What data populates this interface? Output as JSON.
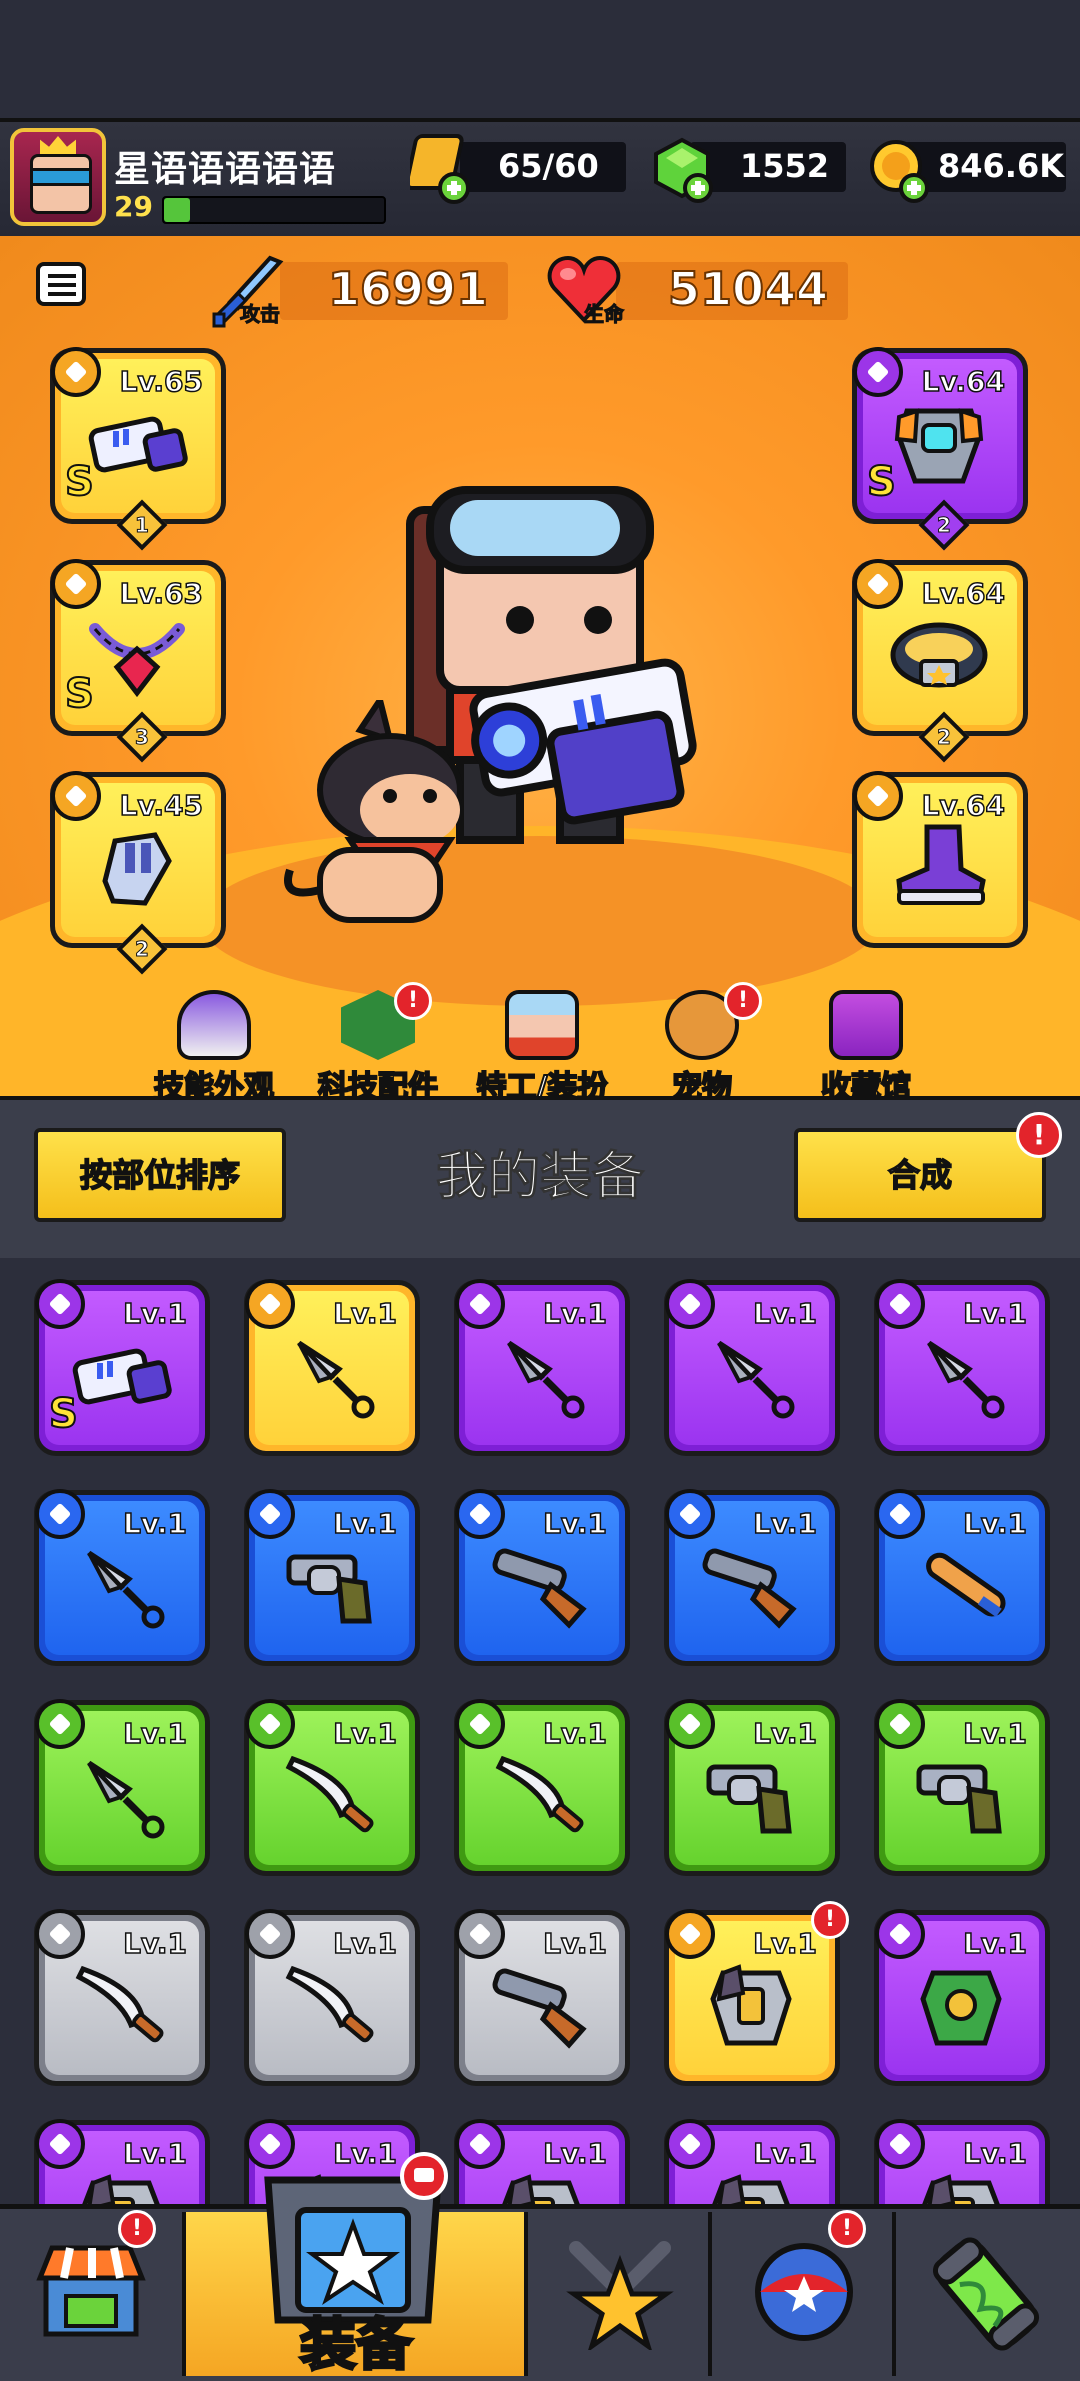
{
  "player": {
    "name": "星语语语语语",
    "level": "29",
    "xp_progress": 0.12
  },
  "resources": [
    {
      "name": "energy",
      "icon": "energy-ticket-icon",
      "value": "65/60"
    },
    {
      "name": "gems",
      "icon": "green-gem-icon",
      "value": "1552"
    },
    {
      "name": "coins",
      "icon": "gold-coin-icon",
      "value": "846.6K"
    }
  ],
  "stats": {
    "attack": {
      "label": "攻击",
      "value": "16991",
      "icon": "sword-icon"
    },
    "health": {
      "label": "生命",
      "value": "51044",
      "icon": "heart-icon"
    }
  },
  "equipped": {
    "left": [
      {
        "level": "Lv.65",
        "grade": "S",
        "star": "1",
        "rarity": "gold",
        "type": "weapon"
      },
      {
        "level": "Lv.63",
        "grade": "S",
        "star": "3",
        "rarity": "gold",
        "type": "necklace"
      },
      {
        "level": "Lv.45",
        "grade": "",
        "star": "2",
        "rarity": "gold",
        "type": "gloves"
      }
    ],
    "right": [
      {
        "level": "Lv.64",
        "grade": "S",
        "star": "2",
        "rarity": "purple",
        "type": "armor"
      },
      {
        "level": "Lv.64",
        "grade": "",
        "star": "2",
        "rarity": "gold",
        "type": "belt"
      },
      {
        "level": "Lv.64",
        "grade": "",
        "star": "",
        "rarity": "gold",
        "type": "boots"
      }
    ]
  },
  "nav": [
    {
      "label": "技能外观",
      "icon": "skill-skin-icon",
      "alert": false
    },
    {
      "label": "科技配件",
      "icon": "tech-part-icon",
      "alert": true
    },
    {
      "label": "特工/装扮",
      "icon": "agent-icon",
      "alert": false
    },
    {
      "label": "宠物",
      "icon": "pet-icon",
      "alert": true
    },
    {
      "label": "收藏馆",
      "icon": "collection-icon",
      "alert": false
    }
  ],
  "equip_section": {
    "sort_label": "按部位排序",
    "title": "我的装备",
    "merge_label": "合成",
    "merge_alert": "!"
  },
  "inventory": [
    [
      {
        "level": "Lv.1",
        "rarity": "purple",
        "item": "blaster",
        "grade": "S"
      },
      {
        "level": "Lv.1",
        "rarity": "gold",
        "item": "kunai"
      },
      {
        "level": "Lv.1",
        "rarity": "purple",
        "item": "kunai"
      },
      {
        "level": "Lv.1",
        "rarity": "purple",
        "item": "kunai"
      },
      {
        "level": "Lv.1",
        "rarity": "purple",
        "item": "kunai"
      }
    ],
    [
      {
        "level": "Lv.1",
        "rarity": "blue",
        "item": "kunai"
      },
      {
        "level": "Lv.1",
        "rarity": "blue",
        "item": "revolver"
      },
      {
        "level": "Lv.1",
        "rarity": "blue",
        "item": "shotgun"
      },
      {
        "level": "Lv.1",
        "rarity": "blue",
        "item": "shotgun"
      },
      {
        "level": "Lv.1",
        "rarity": "blue",
        "item": "bat"
      }
    ],
    [
      {
        "level": "Lv.1",
        "rarity": "green",
        "item": "kunai"
      },
      {
        "level": "Lv.1",
        "rarity": "green",
        "item": "machete"
      },
      {
        "level": "Lv.1",
        "rarity": "green",
        "item": "machete"
      },
      {
        "level": "Lv.1",
        "rarity": "green",
        "item": "revolver"
      },
      {
        "level": "Lv.1",
        "rarity": "green",
        "item": "revolver"
      }
    ],
    [
      {
        "level": "Lv.1",
        "rarity": "gray",
        "item": "machete"
      },
      {
        "level": "Lv.1",
        "rarity": "gray",
        "item": "machete"
      },
      {
        "level": "Lv.1",
        "rarity": "gray",
        "item": "shotgun"
      },
      {
        "level": "Lv.1",
        "rarity": "gold",
        "item": "armor",
        "alert": true
      },
      {
        "level": "Lv.1",
        "rarity": "purple",
        "item": "armor-green"
      }
    ],
    [
      {
        "level": "Lv.1",
        "rarity": "purple",
        "item": "armor"
      },
      {
        "level": "Lv.1",
        "rarity": "purple",
        "item": "armor"
      },
      {
        "level": "Lv.1",
        "rarity": "purple",
        "item": "armor"
      },
      {
        "level": "Lv.1",
        "rarity": "purple",
        "item": "armor"
      },
      {
        "level": "Lv.1",
        "rarity": "purple",
        "item": "armor"
      }
    ]
  ],
  "bottom_tabs": [
    {
      "icon": "shop-icon",
      "alert": true
    },
    {
      "icon": "equipment-icon",
      "label": "装备",
      "active": true
    },
    {
      "icon": "battle-star-icon",
      "alert": false
    },
    {
      "icon": "world-ball-icon",
      "alert": true
    },
    {
      "icon": "dna-capsule-icon",
      "alert": false
    }
  ],
  "colors": {
    "gold": "#ffc83a",
    "purple": "#a43ff2",
    "blue": "#2a6ff2",
    "green": "#7adf3c",
    "gray": "#c6c8ce",
    "accent": "#f4a21d"
  }
}
